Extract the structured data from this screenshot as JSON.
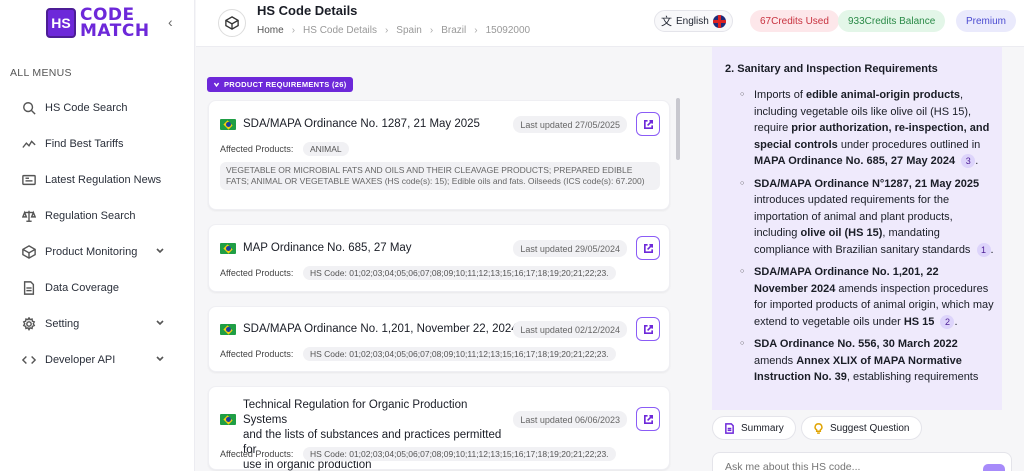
{
  "logo": {
    "mark": "HS",
    "line1": "CODE",
    "line2": "MATCH"
  },
  "sidebar": {
    "section_label": "ALL MENUS",
    "items": [
      {
        "label": "HS Code Search",
        "icon": "search-icon",
        "has_chevron": false
      },
      {
        "label": "Find Best Tariffs",
        "icon": "trend-icon",
        "has_chevron": false
      },
      {
        "label": "Latest Regulation News",
        "icon": "news-icon",
        "has_chevron": false
      },
      {
        "label": "Regulation Search",
        "icon": "scale-icon",
        "has_chevron": false
      },
      {
        "label": "Product Monitoring",
        "icon": "box-icon",
        "has_chevron": true
      },
      {
        "label": "Data Coverage",
        "icon": "document-icon",
        "has_chevron": false
      },
      {
        "label": "Setting",
        "icon": "gear-icon",
        "has_chevron": true
      },
      {
        "label": "Developer API",
        "icon": "code-icon",
        "has_chevron": true
      }
    ]
  },
  "header": {
    "title": "HS Code Details",
    "breadcrumb": [
      "Home",
      "HS Code Details",
      "Spain",
      "Brazil",
      "15092000"
    ],
    "language": "English",
    "credits_used": "67Credits Used",
    "credits_balance": "933Credits Balance",
    "plan": "Premium"
  },
  "requirements": {
    "badge": "PRODUCT REQUIREMENTS (26)",
    "affected_label": "Affected Products:",
    "cards": [
      {
        "title": "SDA/MAPA Ordinance No. 1287, 21 May 2025",
        "updated": "Last updated 27/05/2025",
        "tag": "ANIMAL",
        "desc": "VEGETABLE OR MICROBIAL FATS AND OILS AND THEIR CLEAVAGE PRODUCTS; PREPARED EDIBLE FATS; ANIMAL OR VEGETABLE WAXES (HS code(s): 15); Edible oils and fats. Oilseeds (ICS code(s): 67.200)"
      },
      {
        "title": "MAP Ordinance No. 685, 27 May",
        "updated": "Last updated 29/05/2024",
        "tag": "HS Code: 01;02;03;04;05;06;07;08;09;10;11;12;13;15;16;17;18;19;20;21;22;23."
      },
      {
        "title": "SDA/MAPA Ordinance No. 1,201, November 22, 2024",
        "updated": "Last updated 02/12/2024",
        "tag": "HS Code: 01;02;03;04;05;06;07;08;09;10;11;12;13;15;16;17;18;19;20;21;22;23."
      },
      {
        "title_lines": [
          "Technical Regulation for Organic Production Systems",
          "and the lists of substances and practices permitted for",
          "use in organic production"
        ],
        "updated": "Last updated 06/06/2023",
        "tag": "HS Code: 01;02;03;04;05;06;07;08;09;10;11;12;13;15;16;17;18;19;20;21;22;23."
      }
    ]
  },
  "chat": {
    "heading": "2. Sanitary and Inspection Requirements",
    "cite_1": "3",
    "cite_2": "1",
    "cite_3": "2",
    "summary_label": "Summary",
    "suggest_label": "Suggest Question",
    "input_placeholder": "Ask me about this HS code..."
  },
  "colors": {
    "accent": "#6d28d9",
    "chat_bg": "#efeafc"
  }
}
